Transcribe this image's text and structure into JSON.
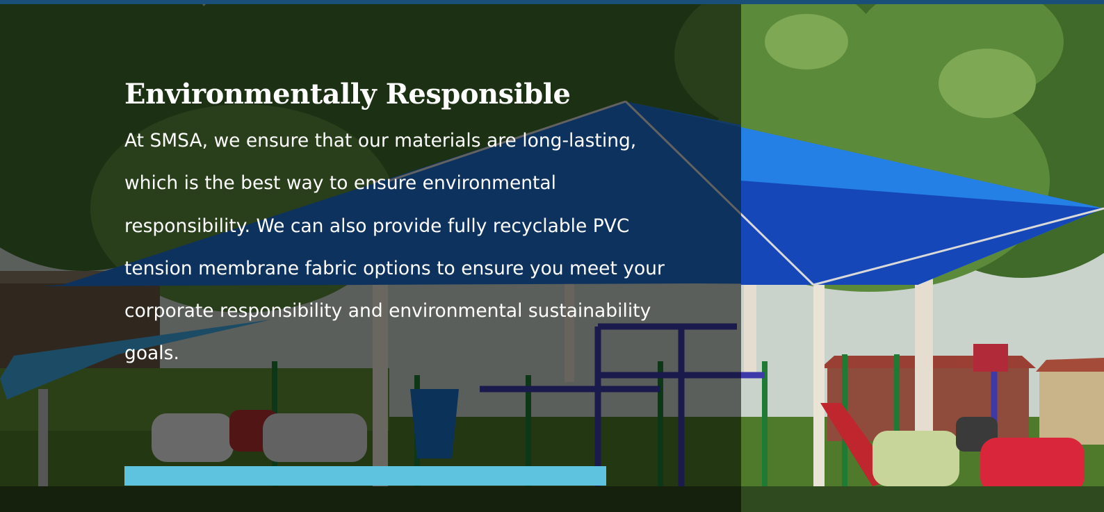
{
  "hero": {
    "heading": "Environmentally Responsible",
    "body": "At SMSA, we ensure that our materials are long-lasting, which is the best way to ensure environmental responsibility. We can also provide fully recyclable PVC tension membrane fabric options to ensure you meet your corporate responsibility and environmental sustainability goals."
  },
  "colors": {
    "top_bar": "#1a4f7a",
    "accent_bar": "#5ec3df",
    "shade_sail": "#1e6fd0"
  },
  "icons": {
    "background": "playground-shade-sail-photo"
  }
}
